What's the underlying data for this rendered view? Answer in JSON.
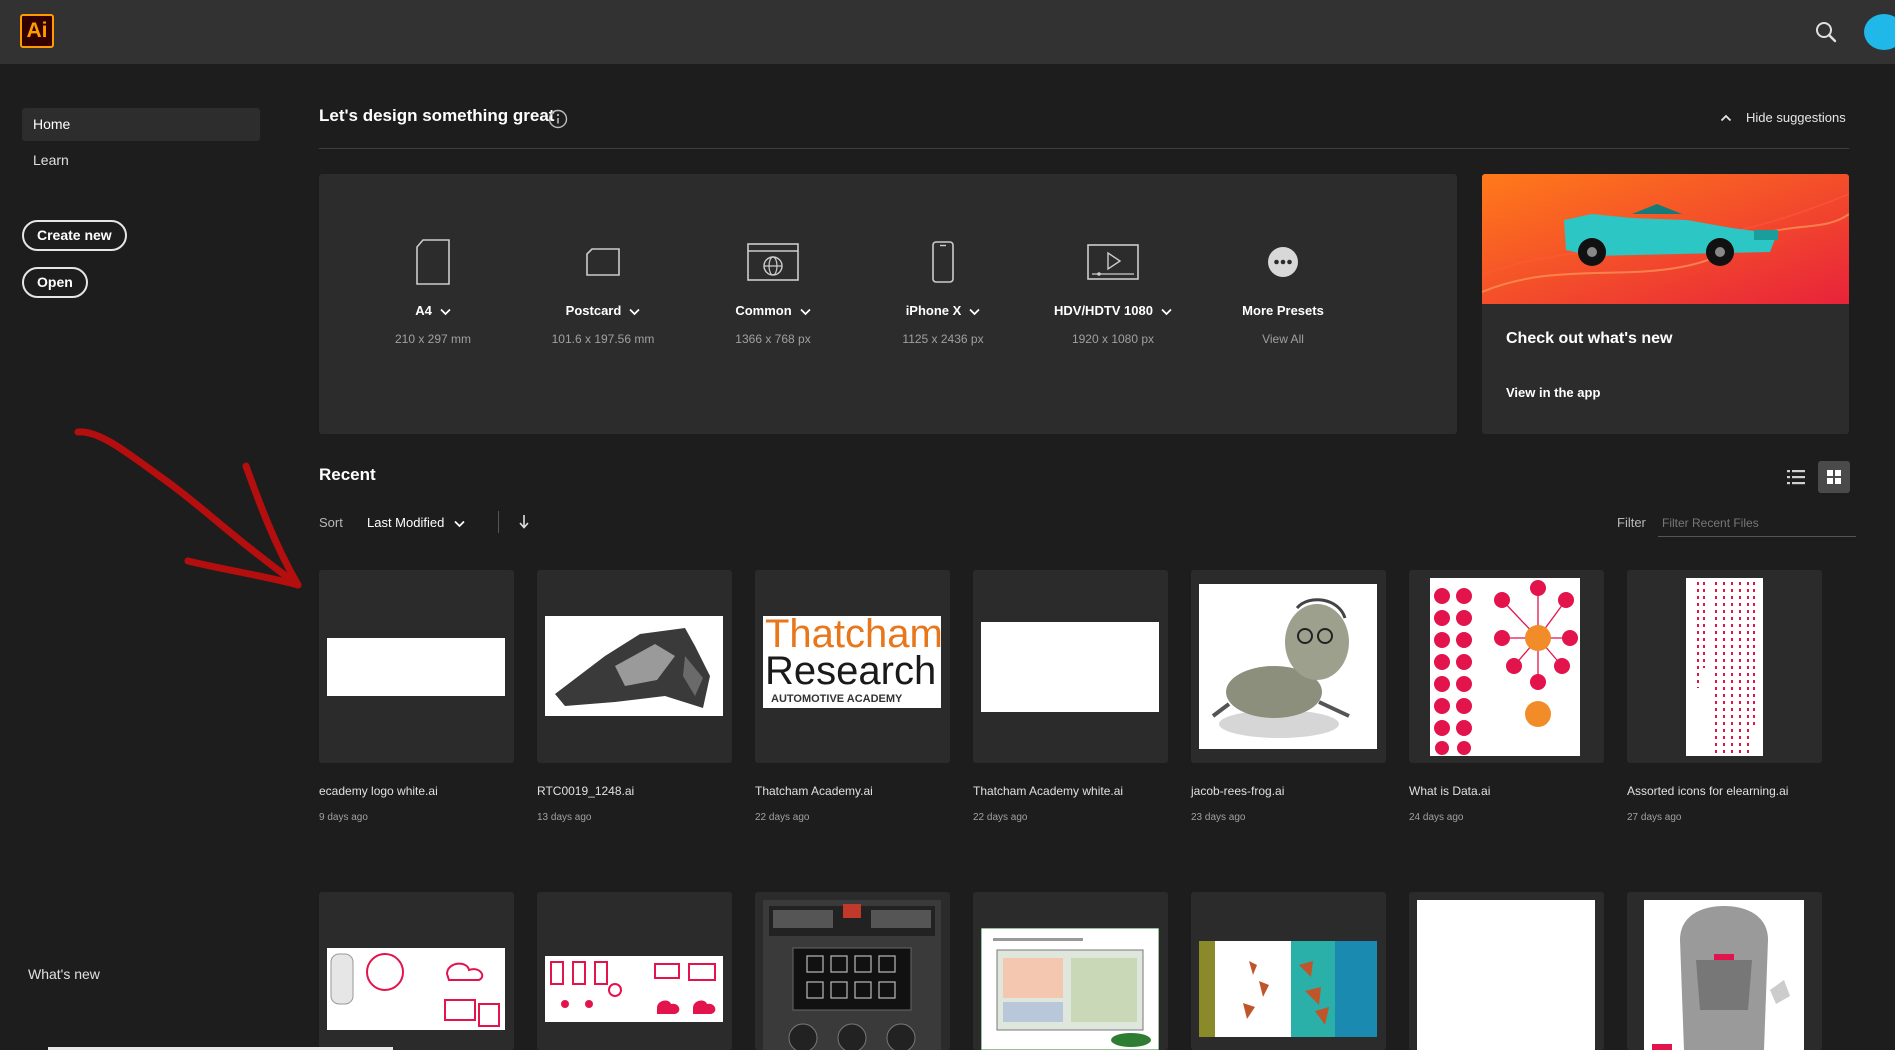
{
  "app": {
    "logo": "Ai"
  },
  "sidebar": {
    "items": [
      {
        "label": "Home"
      },
      {
        "label": "Learn"
      }
    ],
    "create_new_label": "Create new",
    "open_label": "Open",
    "whats_new_label": "What's new"
  },
  "main": {
    "title": "Let's design something great",
    "hide_suggestions_label": "Hide suggestions"
  },
  "presets": [
    {
      "name": "A4",
      "size": "210 x 297 mm",
      "icon": "page-icon"
    },
    {
      "name": "Postcard",
      "size": "101.6 x 197.56 mm",
      "icon": "postcard-icon"
    },
    {
      "name": "Common",
      "size": "1366 x 768 px",
      "icon": "web-icon"
    },
    {
      "name": "iPhone X",
      "size": "1125 x 2436 px",
      "icon": "phone-icon"
    },
    {
      "name": "HDV/HDTV 1080",
      "size": "1920 x 1080 px",
      "icon": "video-icon"
    },
    {
      "name": "More Presets",
      "size": "View All",
      "icon": "more-icon"
    }
  ],
  "promo": {
    "title": "Check out what's new",
    "link": "View in the app"
  },
  "recent": {
    "title": "Recent",
    "sort_label": "Sort",
    "sort_value": "Last Modified",
    "filter_label": "Filter",
    "filter_placeholder": "Filter Recent Files",
    "files": [
      {
        "name": "ecademy logo white.ai",
        "date": "9 days ago"
      },
      {
        "name": "RTC0019_1248.ai",
        "date": "13 days ago"
      },
      {
        "name": "Thatcham Academy.ai",
        "date": "22 days ago"
      },
      {
        "name": "Thatcham Academy white.ai",
        "date": "22 days ago"
      },
      {
        "name": "jacob-rees-frog.ai",
        "date": "23 days ago"
      },
      {
        "name": "What is Data.ai",
        "date": "24 days ago"
      },
      {
        "name": "Assorted icons for elearning.ai",
        "date": "27 days ago"
      }
    ],
    "thumb_text": {
      "line1": "Thatcham",
      "line2": "Research",
      "line3": "AUTOMOTIVE ACADEMY"
    }
  },
  "colors": {
    "brand": "#ff9a00",
    "accent_red": "#e3134c",
    "background": "#1d1d1d",
    "panel": "#2c2c2c"
  }
}
